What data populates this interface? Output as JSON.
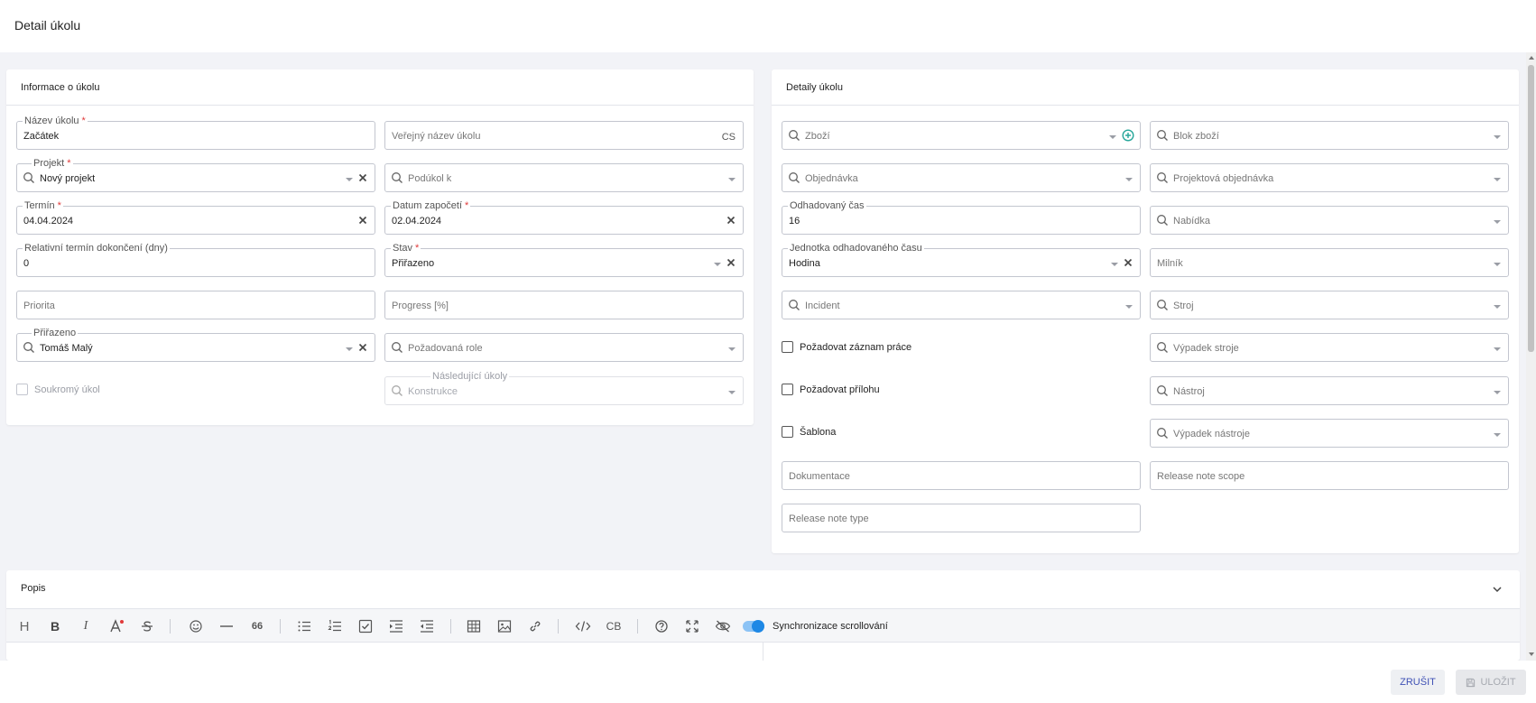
{
  "page": {
    "title": "Detail úkolu"
  },
  "info_card": {
    "title": "Informace o úkolu",
    "task_name": {
      "label": "Název úkolu",
      "value": "Začátek"
    },
    "public_name": {
      "placeholder": "Veřejný název úkolu",
      "lang": "CS"
    },
    "project": {
      "label": "Projekt",
      "value": "Nový projekt"
    },
    "subtask_of": {
      "placeholder": "Podúkol k"
    },
    "deadline": {
      "label": "Termín",
      "value": "04.04.2024"
    },
    "start_date": {
      "label": "Datum započetí",
      "value": "02.04.2024"
    },
    "relative_deadline": {
      "label": "Relativní termín dokončení (dny)",
      "value": "0"
    },
    "status": {
      "label": "Stav",
      "value": "Přiřazeno"
    },
    "priority": {
      "placeholder": "Priorita"
    },
    "progress": {
      "placeholder": "Progress [%]"
    },
    "assigned": {
      "label": "Přiřazeno",
      "value": "Tomáš Malý"
    },
    "required_role": {
      "placeholder": "Požadovaná role"
    },
    "private_task": {
      "label": "Soukromý úkol"
    },
    "following_tasks": {
      "label": "Následující úkoly",
      "placeholder": "Konstrukce"
    }
  },
  "details_card": {
    "title": "Detaily úkolu",
    "goods": {
      "placeholder": "Zboží"
    },
    "goods_block": {
      "placeholder": "Blok zboží"
    },
    "order": {
      "placeholder": "Objednávka"
    },
    "project_order": {
      "placeholder": "Projektová objednávka"
    },
    "estimated_time": {
      "label": "Odhadovaný čas",
      "value": "16"
    },
    "offer": {
      "placeholder": "Nabídka"
    },
    "time_unit": {
      "label": "Jednotka odhadovaného času",
      "value": "Hodina"
    },
    "milestone": {
      "placeholder": "Milník"
    },
    "incident": {
      "placeholder": "Incident"
    },
    "machine": {
      "placeholder": "Stroj"
    },
    "require_worklog": {
      "label": "Požadovat záznam práce"
    },
    "machine_failure": {
      "placeholder": "Výpadek stroje"
    },
    "require_attachment": {
      "label": "Požadovat přílohu"
    },
    "tool": {
      "placeholder": "Nástroj"
    },
    "template": {
      "label": "Šablona"
    },
    "tool_failure": {
      "placeholder": "Výpadek nástroje"
    },
    "documentation": {
      "placeholder": "Dokumentace"
    },
    "release_note_scope": {
      "placeholder": "Release note scope"
    },
    "release_note_type": {
      "placeholder": "Release note type"
    }
  },
  "description_card": {
    "title": "Popis",
    "toolbar": {
      "heading": "H",
      "bold": "B",
      "italic": "I",
      "quote": "66",
      "code_block": "CB",
      "sync_label": "Synchronizace scrollování",
      "sync_enabled": true
    }
  },
  "footer": {
    "cancel_label": "ZRUŠIT",
    "save_label": "ULOŽIT"
  },
  "colors": {
    "accent": "#1e88e5",
    "required": "#e03a3a",
    "success": "#26a69a",
    "cancel_text": "#3f51b5"
  }
}
